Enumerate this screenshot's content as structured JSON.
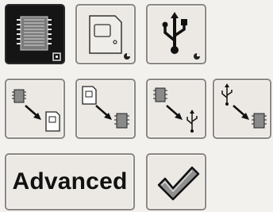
{
  "screen": {
    "row1": {
      "items": [
        {
          "icon": "chip-icon",
          "selected": true
        },
        {
          "icon": "sd-card-icon",
          "selected": false
        },
        {
          "icon": "usb-icon",
          "selected": false
        }
      ]
    },
    "row2": {
      "items": [
        {
          "icon": "chip-to-sd-icon"
        },
        {
          "icon": "sd-to-chip-icon"
        },
        {
          "icon": "chip-to-usb-icon"
        },
        {
          "icon": "usb-to-chip-icon"
        }
      ]
    },
    "row3": {
      "advanced_label": "Advanced",
      "confirm_icon": "checkmark-icon"
    }
  }
}
